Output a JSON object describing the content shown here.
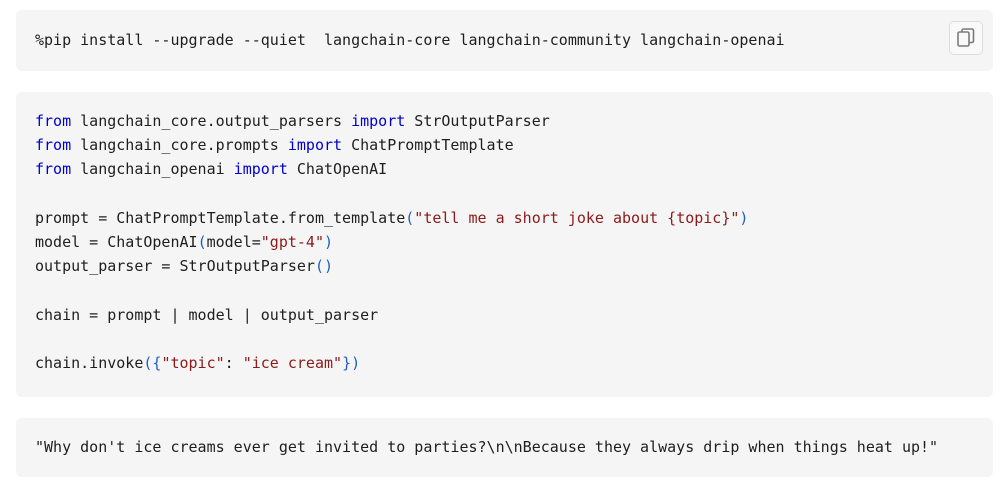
{
  "install": {
    "command": "%pip install --upgrade --quiet  langchain-core langchain-community langchain-openai",
    "copy_icon": "copy-icon"
  },
  "code": {
    "line1": {
      "kw1": "from",
      "mod": " langchain_core.output_parsers ",
      "kw2": "import",
      "name": " StrOutputParser"
    },
    "line2": {
      "kw1": "from",
      "mod": " langchain_core.prompts ",
      "kw2": "import",
      "name": " ChatPromptTemplate"
    },
    "line3": {
      "kw1": "from",
      "mod": " langchain_openai ",
      "kw2": "import",
      "name": " ChatOpenAI"
    },
    "line4": {
      "pre": "prompt = ChatPromptTemplate.from_template",
      "open": "(",
      "str": "\"tell me a short joke about {topic}\"",
      "close": ")"
    },
    "line5": {
      "pre": "model = ChatOpenAI",
      "open": "(",
      "arg": "model=",
      "str": "\"gpt-4\"",
      "close": ")"
    },
    "line6": {
      "pre": "output_parser = StrOutputParser",
      "parens": "()"
    },
    "line7": {
      "text": "chain = prompt | model | output_parser"
    },
    "line8": {
      "pre": "chain.invoke",
      "open": "({",
      "str1": "\"topic\"",
      "mid": ": ",
      "str2": "\"ice cream\"",
      "close": "})"
    }
  },
  "output": {
    "text": "\"Why don't ice creams ever get invited to parties?\\n\\nBecause they always drip when things heat up!\""
  }
}
